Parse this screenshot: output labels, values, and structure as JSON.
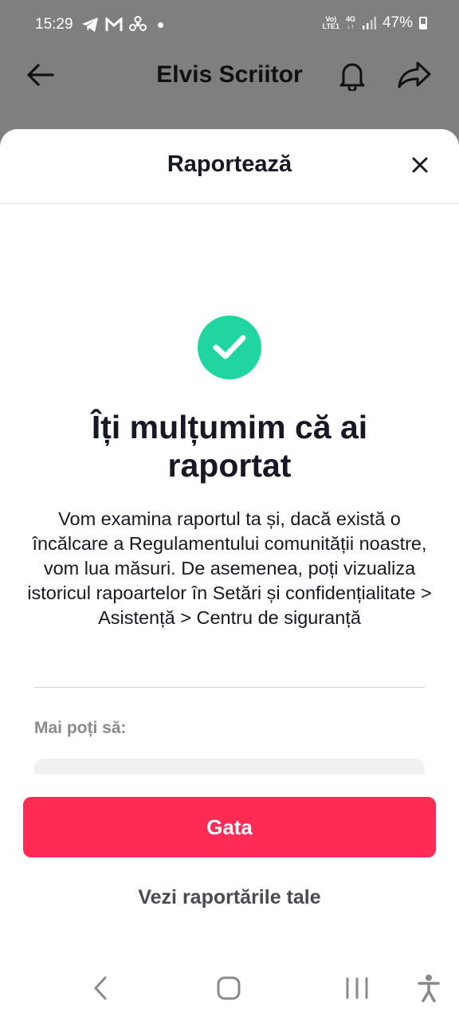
{
  "status_bar": {
    "time": "15:29",
    "network_top": "Vo)",
    "network_bottom": "LTE1",
    "data_top": "4G",
    "data_bottom": "↓↑",
    "battery": "47%"
  },
  "profile_header": {
    "name": "Elvis Scriitor"
  },
  "sheet": {
    "title": "Raportează",
    "headline": "Îți mulțumim că ai raportat",
    "body": "Vom examina raportul ta și, dacă există o încălcare a Regulamentului comunității noastre, vom lua măsuri. De asemenea, poți vizualiza istoricul rapoartelor în Setări și confidențialitate > Asistență > Centru de siguranță",
    "more_label": "Mai poți să:",
    "done_button": "Gata",
    "view_reports_link": "Vezi raportările tale"
  },
  "colors": {
    "accent": "#fe2c55",
    "success": "#20d5a0",
    "overlay": "#7f7f7f"
  }
}
